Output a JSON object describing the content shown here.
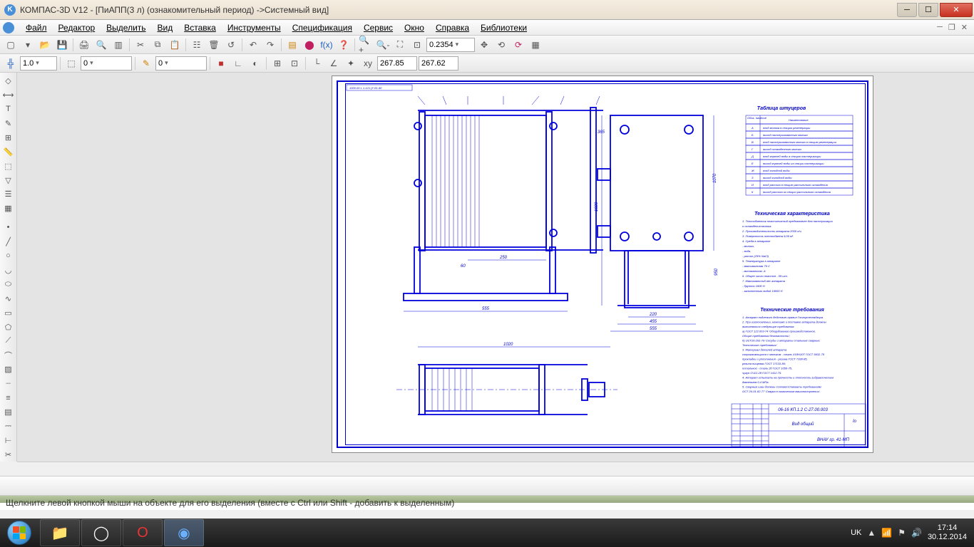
{
  "window": {
    "title": "КОМПАС-3D V12 - [ПиАПП(3 л) (ознакомительный период) ->Системный вид]"
  },
  "menu": {
    "file": "Файл",
    "edit": "Редактор",
    "select": "Выделить",
    "view": "Вид",
    "insert": "Вставка",
    "tools": "Инструменты",
    "spec": "Спецификация",
    "service": "Сервис",
    "window": "Окно",
    "help": "Справка",
    "lib": "Библиотеки"
  },
  "toolbar": {
    "zoom_value": "0.2354",
    "line_w": "1.0",
    "layer": "0",
    "style": "0",
    "coord_x": "267.85",
    "coord_y": "267.62"
  },
  "drawing": {
    "nozzle_table_title": "Таблица штуцеров",
    "col_desig": "Обоз-\nначение",
    "col_name": "Наименование",
    "rows": [
      {
        "d": "А",
        "n": "вход молока в секцию регенерации"
      },
      {
        "d": "Б",
        "n": "выход пастеризованного молока"
      },
      {
        "d": "В",
        "n": "вход пастеризованного молока в секцию регенерации"
      },
      {
        "d": "Г",
        "n": "выход охлажденного молока"
      },
      {
        "d": "Д",
        "n": "вход горячей воды в секцию пастеризации"
      },
      {
        "d": "Е",
        "n": "выход горячей воды из секции пастеризации"
      },
      {
        "d": "Ж",
        "n": "вход холодной воды"
      },
      {
        "d": "З",
        "n": "выход холодной воды"
      },
      {
        "d": "И",
        "n": "вход рассола в секцию рассольного охлаждения"
      },
      {
        "d": "К",
        "n": "выход рассола из секции рассольного охлаждения"
      }
    ],
    "tech_char_title": "Техническая характеристика",
    "tech_char_lines": [
      "1. Теплообменник пластинчатый предназначен для пастеризации",
      "   и охлаждения молока.",
      "2. Производительность аппарата 2000 л/ч.",
      "3. Поверхность теплообмена 9,06 м².",
      "4. Среда в аппарате",
      "                         - молоко,",
      "                         - вода,",
      "                         - рассол (25% NaCl)",
      "5. Температура в аппарате",
      "                         - максимальная 79 С",
      "                         - минимальная -4.",
      "6. Общее число пластин - 59 шт.",
      "7. Максимальный вес аппарата",
      "                         - брутто 1600 Н",
      "                         - заполненного водой 19000 Н"
    ],
    "tech_req_title": "Технические требования",
    "tech_req_lines": [
      "1. Аппарат подлежит действию правил Госгортехнадзора.",
      "2. При изготовлении, монтаже и поставке аппарата должны",
      "   выполняться следующие требования:",
      "   а) ГОСТ 122.003-74 'Оборудование производственное.",
      "      Общие требования безопасности';",
      "   б) ОСТ26-291-79 'Сосуды и аппараты стальные сварные.",
      "      Технические требования'.",
      "3. Материал деталей аппарата",
      "   соприкасающихся с молоком - сталь Х18Н10Т ГОСТ 5632-75",
      "   прокладки и уплотнения - резина ГОСТ 7338-85,",
      "                            резина пищевая ГОСТ 17133-80;",
      "   остальное - сталь 20 ГОСТ 1050-75,",
      "               чугун СЧ12-28 ГОСТ 1412-75.",
      "4. Аппарат испытать на прочность и плотность гидравлическим",
      "   давлением 0,4 МПа.",
      "5. Сварные швы должны соответствовать требованиям",
      "   ОСТ 26-01-82-77 'Сварка в химическом машиностроении'."
    ],
    "title_block": {
      "code": "06-16 КП.1.2 С-27.00.003",
      "name": "Вид общий",
      "group": "ВНАУ гр. 41-МП",
      "lit": "Iо",
      "stamp_ref": "1000.00 L 1-121 (У 81-90"
    },
    "dims": {
      "d250": "250",
      "d555": "555",
      "d220": "220",
      "d455": "455",
      "d1070": "1070",
      "d1020_h": "1020",
      "d365": "365",
      "d950": "950",
      "d60": "60"
    }
  },
  "status": {
    "hint": "Щелкните левой кнопкой мыши на объекте для его выделения (вместе с Ctrl или Shift - добавить к выделенным)"
  },
  "taskbar": {
    "lang": "UK",
    "time": "17:14",
    "date": "30.12.2014"
  }
}
